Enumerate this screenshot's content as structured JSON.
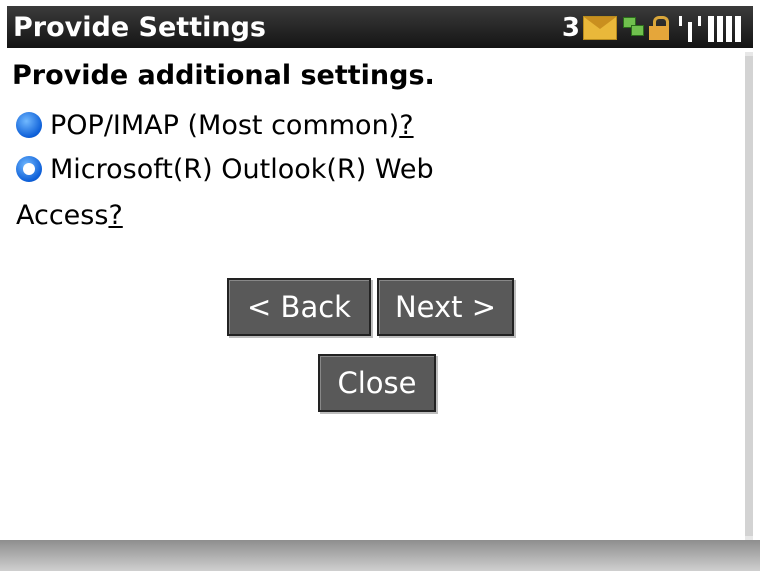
{
  "window": {
    "title": "Provide Settings"
  },
  "status": {
    "message_count": "3",
    "icons": [
      "envelope-icon",
      "bbm-icon",
      "lock-icon",
      "antenna-icon",
      "signal-bars-icon"
    ]
  },
  "main": {
    "heading": "Provide additional settings.",
    "options": [
      {
        "label": "POP/IMAP (Most common)",
        "help": "?",
        "selected": false
      },
      {
        "label_line1": "Microsoft(R) Outlook(R) Web",
        "label_line2": "Access",
        "help": "?",
        "selected": true
      }
    ],
    "buttons": {
      "back": "< Back",
      "next": "Next >",
      "close": "Close"
    }
  },
  "colors": {
    "titlebar": "#1f1f1f",
    "button": "#595959",
    "radio": "#0d5fd8",
    "envelope": "#e9b83a"
  }
}
